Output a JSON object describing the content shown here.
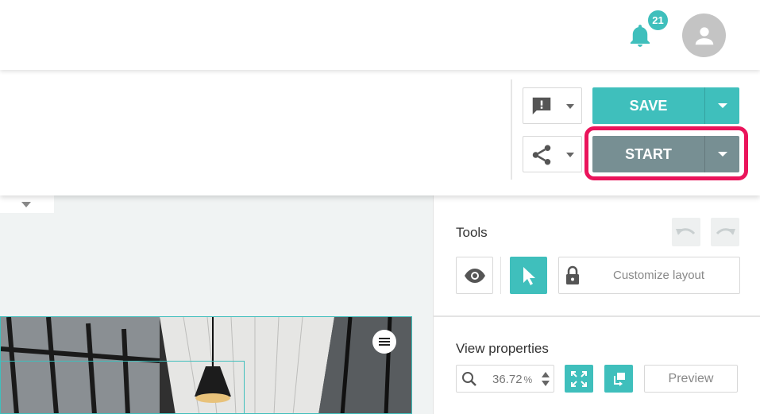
{
  "header": {
    "notifications_count": "21",
    "notifications_icon": "bell-icon",
    "avatar_icon": "person-icon"
  },
  "actions": {
    "comment_icon": "comment-alert-icon",
    "share_icon": "share-icon",
    "save_label": "SAVE",
    "start_label": "START"
  },
  "tools": {
    "title": "Tools",
    "customize_layout": "Customize layout"
  },
  "view_properties": {
    "title": "View properties",
    "zoom_value": "36.72",
    "zoom_unit": "%",
    "preview_label": "Preview"
  },
  "colors": {
    "accent": "#3fbfbc",
    "start": "#778f93",
    "highlight": "#ea145b"
  }
}
